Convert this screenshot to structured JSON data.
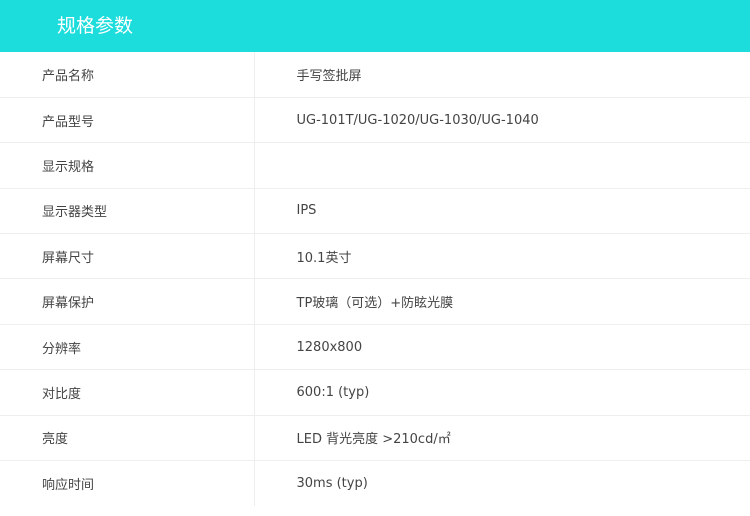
{
  "header": {
    "title": "规格参数"
  },
  "specs": [
    {
      "label": "产品名称",
      "value": "手写签批屏"
    },
    {
      "label": "产品型号",
      "value": "UG-101T/UG-1020/UG-1030/UG-1040"
    },
    {
      "label": "显示规格",
      "value": ""
    },
    {
      "label": "显示器类型",
      "value": "IPS"
    },
    {
      "label": "屏幕尺寸",
      "value": "10.1英寸"
    },
    {
      "label": "屏幕保护",
      "value": "TP玻璃（可选）+防眩光膜"
    },
    {
      "label": "分辨率",
      "value": "1280x800"
    },
    {
      "label": "对比度",
      "value": "600:1 (typ)"
    },
    {
      "label": "亮度",
      "value": "LED 背光亮度 >210cd/㎡"
    },
    {
      "label": "响应时间",
      "value": "30ms (typ)"
    }
  ],
  "colors": {
    "header_bg": "#1cdcdc",
    "header_text": "#ffffff",
    "cell_text": "#444444",
    "border": "#eeeeee"
  }
}
